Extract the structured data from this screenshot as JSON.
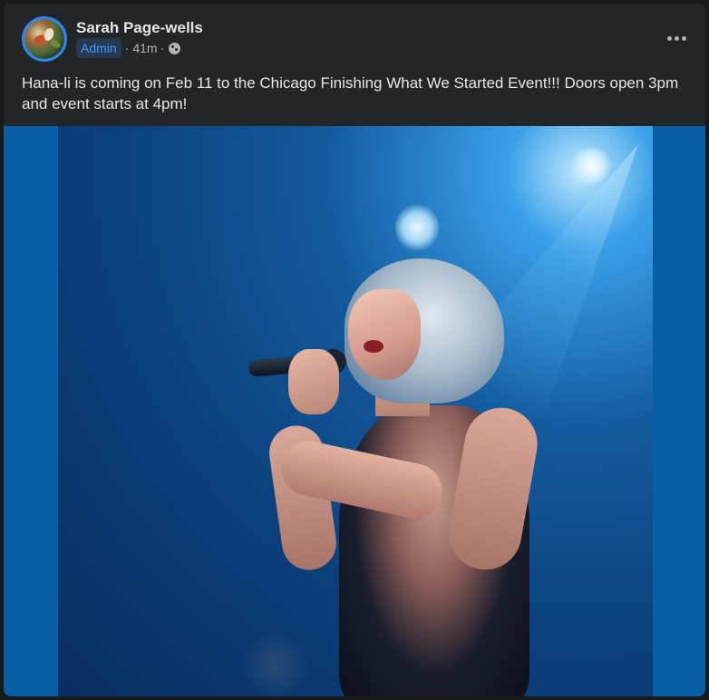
{
  "post": {
    "author": "Sarah Page-wells",
    "badge": "Admin",
    "time": "41m",
    "separator": "·",
    "audience_icon": "globe-icon",
    "more_icon": "more-options-icon",
    "text": "Hana-li is coming on Feb 11 to the Chicago Finishing What We Started Event!!! Doors open 3pm and event starts at 4pm!"
  },
  "colors": {
    "background": "#18191a",
    "card": "#242526",
    "text_primary": "#e4e6eb",
    "text_secondary": "#b0b3b8",
    "badge_bg": "#263951",
    "badge_text": "#4599ff",
    "avatar_ring": "#2d88ff",
    "photo_letterbox": "#0a5fa3"
  }
}
